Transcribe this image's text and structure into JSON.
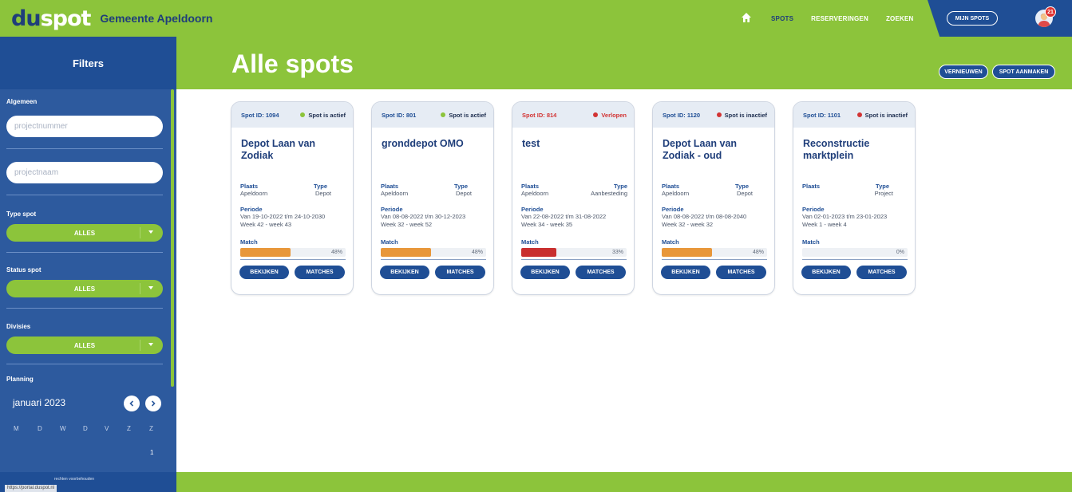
{
  "brand": {
    "logo_du": "du",
    "logo_spot": "spot",
    "org": "Gemeente Apeldoorn"
  },
  "nav": {
    "links": [
      "SPOTS",
      "RESERVERINGEN",
      "ZOEKEN"
    ],
    "active": "SPOTS",
    "mijn_spots": "MIJN SPOTS",
    "notification_count": "21"
  },
  "page": {
    "title": "Alle spots",
    "btn_refresh": "VERNIEUWEN",
    "btn_create": "SPOT AANMAKEN"
  },
  "sidebar": {
    "title": "Filters",
    "general_label": "Algemeen",
    "projectnummer_placeholder": "projectnummer",
    "projectnaam_placeholder": "projectnaam",
    "type_label": "Type spot",
    "type_value": "ALLES",
    "status_label": "Status spot",
    "status_value": "ALLES",
    "divisies_label": "Divisies",
    "divisies_value": "ALLES",
    "planning_label": "Planning",
    "month": "januari 2023",
    "weekdays": [
      "M",
      "D",
      "W",
      "D",
      "V",
      "Z",
      "Z"
    ],
    "first_day": "1",
    "copyright": "rechten voorbehouden",
    "status_url": "https://portal.duspot.nl"
  },
  "cards": [
    {
      "id": "Spot ID: 1094",
      "status": "Spot is actief",
      "status_color": "#8cc43b",
      "status_red": false,
      "title": "Depot Laan van Zodiak",
      "plaats_label": "Plaats",
      "plaats": "Apeldoorn",
      "type_label": "Type",
      "type": "Depot",
      "periode_label": "Periode",
      "periode": "Van 19-10-2022 t/m 24-10-2030",
      "week": "Week 42 - week 43",
      "match_label": "Match",
      "match": 48,
      "match_text": "48%",
      "bar_color": "#e8973a",
      "btn_view": "BEKIJKEN",
      "btn_matches": "MATCHES"
    },
    {
      "id": "Spot ID: 801",
      "status": "Spot is actief",
      "status_color": "#8cc43b",
      "status_red": false,
      "title": "gronddepot OMO",
      "plaats_label": "Plaats",
      "plaats": "Apeldoorn",
      "type_label": "Type",
      "type": "Depot",
      "periode_label": "Periode",
      "periode": "Van 08-08-2022 t/m 30-12-2023",
      "week": "Week 32 - week 52",
      "match_label": "Match",
      "match": 48,
      "match_text": "48%",
      "bar_color": "#e8973a",
      "btn_view": "BEKIJKEN",
      "btn_matches": "MATCHES"
    },
    {
      "id": "Spot ID: 814",
      "status": "Verlopen",
      "status_color": "#d23434",
      "status_red": true,
      "title": "test",
      "plaats_label": "Plaats",
      "plaats": "Apeldoorn",
      "type_label": "Type",
      "type": "Aanbesteding",
      "periode_label": "Periode",
      "periode": "Van 22-08-2022 t/m 31-08-2022",
      "week": "Week 34 - week 35",
      "match_label": "Match",
      "match": 33,
      "match_text": "33%",
      "bar_color": "#c92f2f",
      "btn_view": "BEKIJKEN",
      "btn_matches": "MATCHES"
    },
    {
      "id": "Spot ID: 1120",
      "status": "Spot is inactief",
      "status_color": "#d23434",
      "status_red": false,
      "title": "Depot Laan van Zodiak - oud",
      "plaats_label": "Plaats",
      "plaats": "Apeldoorn",
      "type_label": "Type",
      "type": "Depot",
      "periode_label": "Periode",
      "periode": "Van 08-08-2022 t/m 08-08-2040",
      "week": "Week 32 - week 32",
      "match_label": "Match",
      "match": 48,
      "match_text": "48%",
      "bar_color": "#e8973a",
      "btn_view": "BEKIJKEN",
      "btn_matches": "MATCHES"
    },
    {
      "id": "Spot ID: 1101",
      "status": "Spot is inactief",
      "status_color": "#d23434",
      "status_red": false,
      "title": "Reconstructie marktplein",
      "plaats_label": "Plaats",
      "plaats": "",
      "type_label": "Type",
      "type": "Project",
      "periode_label": "Periode",
      "periode": "Van 02-01-2023 t/m 23-01-2023",
      "week": "Week 1 - week 4",
      "match_label": "Match",
      "match": 0,
      "match_text": "0%",
      "bar_color": "#e8973a",
      "btn_view": "BEKIJKEN",
      "btn_matches": "MATCHES"
    }
  ]
}
